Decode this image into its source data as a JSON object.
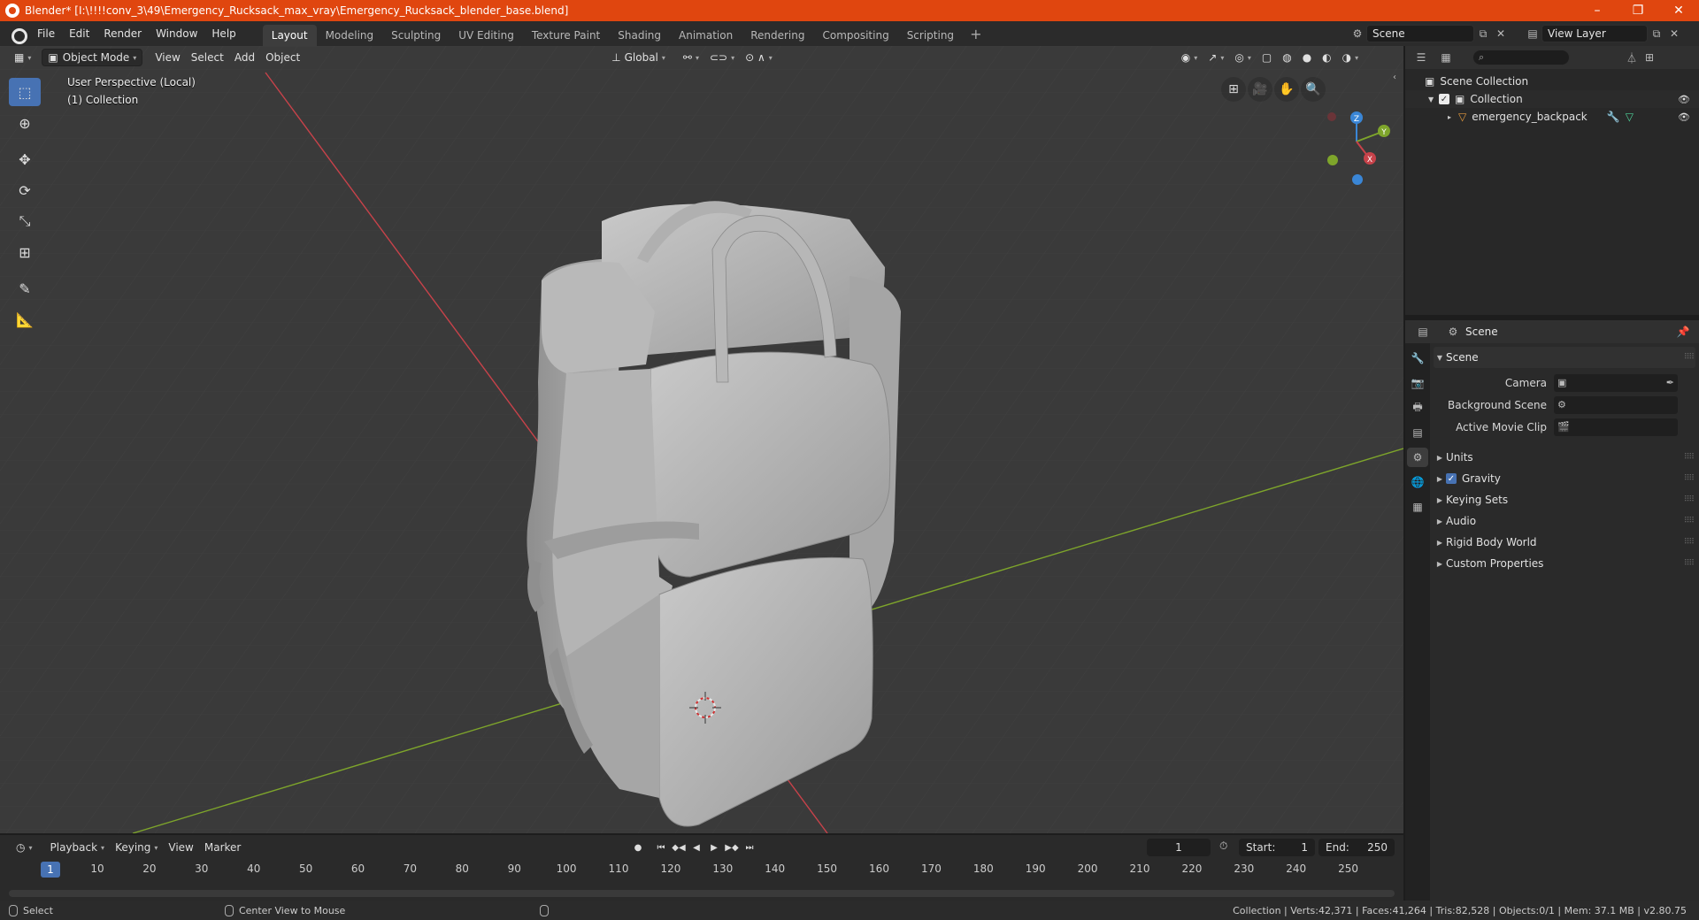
{
  "window": {
    "title": "Blender* [I:\\!!!!conv_3\\49\\Emergency_Rucksack_max_vray\\Emergency_Rucksack_blender_base.blend]",
    "minimize": "–",
    "maximize": "❐",
    "close": "✕"
  },
  "menus": [
    "File",
    "Edit",
    "Render",
    "Window",
    "Help"
  ],
  "workspaces": [
    "Layout",
    "Modeling",
    "Sculpting",
    "UV Editing",
    "Texture Paint",
    "Shading",
    "Animation",
    "Rendering",
    "Compositing",
    "Scripting"
  ],
  "active_workspace": "Layout",
  "add_workspace": "+",
  "scene_selector": {
    "value": "Scene"
  },
  "view_layer_selector": {
    "value": "View Layer"
  },
  "viewport": {
    "mode": "Object Mode",
    "menus": [
      "View",
      "Select",
      "Add",
      "Object"
    ],
    "orientation": "Global",
    "info_line1": "User Perspective (Local)",
    "info_line2": "(1) Collection",
    "gizmo_labels": {
      "z": "Z",
      "y": "Y",
      "x": "X"
    }
  },
  "outliner": {
    "root": "Scene Collection",
    "collection": "Collection",
    "object": "emergency_backpack"
  },
  "properties": {
    "header_title": "Scene",
    "panel_title": "Scene",
    "fields": [
      {
        "label": "Camera"
      },
      {
        "label": "Background Scene"
      },
      {
        "label": "Active Movie Clip"
      }
    ],
    "subpanels": [
      "Units",
      "Gravity",
      "Keying Sets",
      "Audio",
      "Rigid Body World",
      "Custom Properties"
    ],
    "gravity_checked": true
  },
  "timeline": {
    "menus": [
      "Playback",
      "Keying",
      "View",
      "Marker"
    ],
    "current_frame": "1",
    "start_label": "Start:",
    "start_value": "1",
    "end_label": "End:",
    "end_value": "250",
    "ruler_current": "1",
    "ruler_ticks": [
      "10",
      "20",
      "30",
      "40",
      "50",
      "60",
      "70",
      "80",
      "90",
      "100",
      "110",
      "120",
      "130",
      "140",
      "150",
      "160",
      "170",
      "180",
      "190",
      "200",
      "210",
      "220",
      "230",
      "240",
      "250"
    ]
  },
  "statusbar": {
    "select": "Select",
    "center_view": "Center View to Mouse",
    "stats": "Collection | Verts:42,371 | Faces:41,264 | Tris:82,528 | Objects:0/1 | Mem: 37.1 MB | v2.80.75"
  },
  "colors": {
    "titlebar": "#e0460f",
    "accent": "#4772b3",
    "x_axis": "#c7424a",
    "y_axis": "#7ea52b",
    "z_axis": "#3a86d6"
  },
  "icons": [
    "blender-logo-icon",
    "cursor-icon",
    "move-icon",
    "rotate-icon",
    "scale-icon",
    "transform-icon",
    "annotate-icon",
    "measure-icon",
    "grid-view-icon",
    "camera-view-icon",
    "hand-pan-icon",
    "zoom-icon",
    "eye-icon",
    "wrench-icon",
    "mesh-icon",
    "pin-icon",
    "filter-icon",
    "search-icon"
  ]
}
